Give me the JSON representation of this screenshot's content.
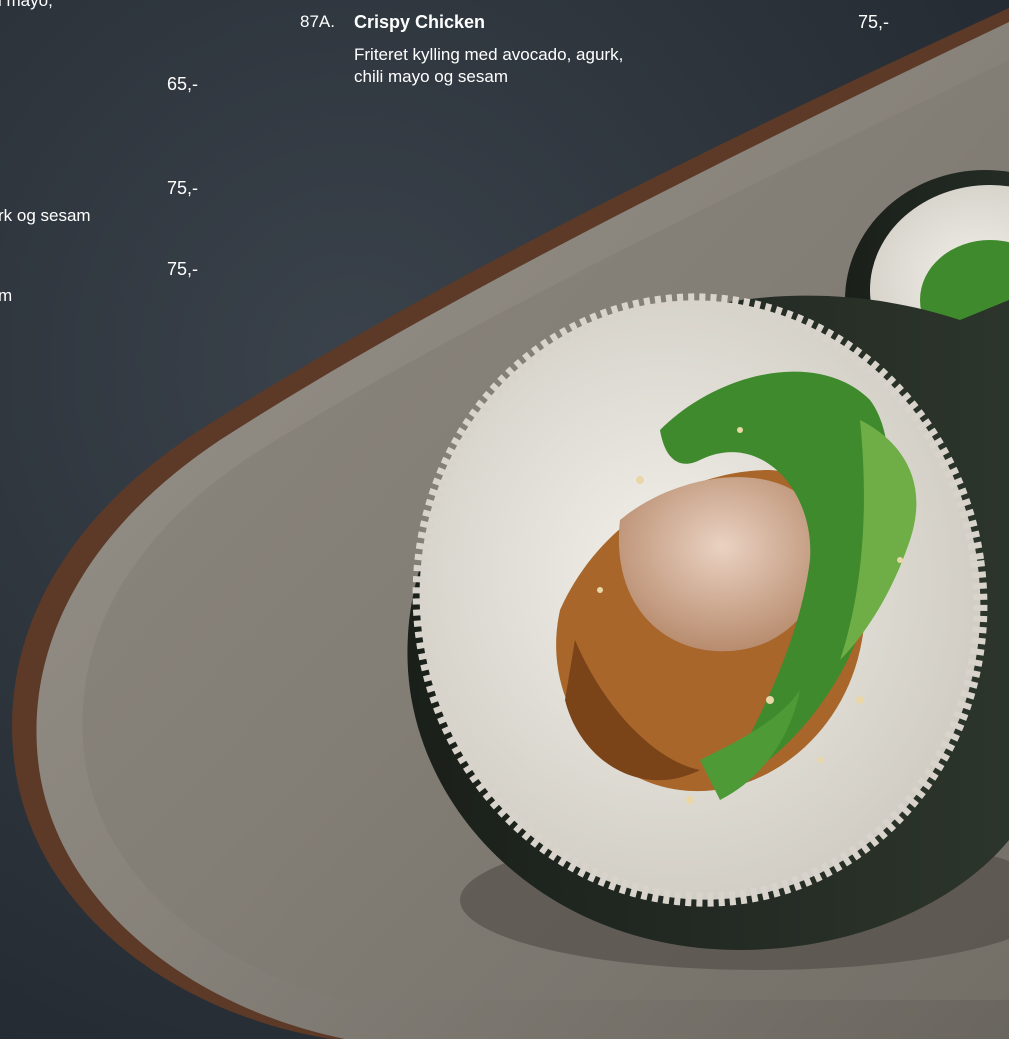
{
  "menu_item": {
    "code": "87A.",
    "name": "Crispy Chicken",
    "description_line1": "Friteret kylling med avocado, agurk,",
    "description_line2": "chili mayo og sesam",
    "price": "75,-"
  },
  "left_column": {
    "fragment_top": "i mayo,",
    "price_1": "65,-",
    "price_2": "75,-",
    "fragment_mid": "rk og sesam",
    "price_3": "75,-",
    "fragment_bottom": "m"
  },
  "colors": {
    "background": "#2d343c",
    "plate": "#8c877f",
    "plate_rim": "#6b4632",
    "text": "#ffffff",
    "rice": "#e8e6df",
    "nori": "#1f2620",
    "lettuce": "#3f8a2c",
    "chicken": "#d9b9a4",
    "fried_crust": "#a8662a"
  }
}
